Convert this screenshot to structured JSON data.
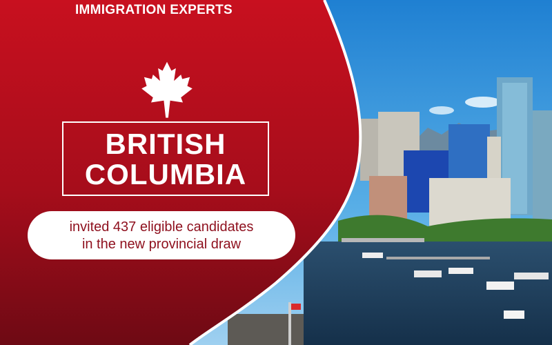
{
  "brand": {
    "name": "IMMIGRATION EXPERTS"
  },
  "headline": {
    "line1": "BRITISH",
    "line2": "COLUMBIA"
  },
  "tagline": {
    "line1": "invited 437 eligible candidates",
    "line2": "in the new provincial draw"
  },
  "icons": {
    "leaf": "maple-leaf-icon"
  },
  "colors": {
    "banner_red": "#b0101f",
    "banner_dark": "#6e0a14",
    "pill_text": "#8e0f1d",
    "sky": "#2f8fd8",
    "water": "#1d3d5c"
  }
}
